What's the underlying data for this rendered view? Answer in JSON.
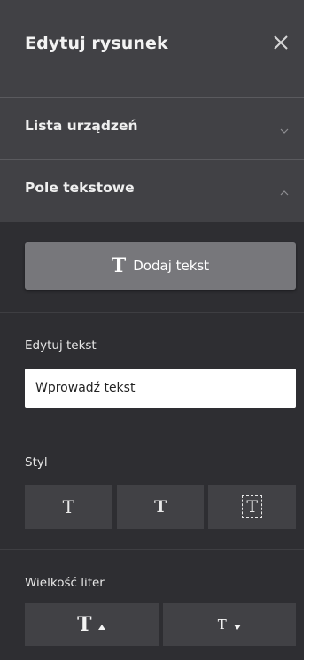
{
  "header": {
    "title": "Edytuj rysunek",
    "close_icon": "close-icon"
  },
  "sections": [
    {
      "label": "Lista urządzeń",
      "expanded": false,
      "icon": "chevron-down-icon"
    },
    {
      "label": "Pole tekstowe",
      "expanded": true,
      "icon": "chevron-up-icon"
    }
  ],
  "text_box": {
    "add_button": {
      "icon": "T",
      "label": "Dodaj tekst"
    },
    "edit_label": "Edytuj tekst",
    "input": {
      "value": "",
      "placeholder": "Wprowadź tekst"
    },
    "style_label": "Styl",
    "style_buttons": [
      {
        "icon": "T",
        "name": "text-style-normal"
      },
      {
        "icon": "T",
        "name": "text-style-bold"
      },
      {
        "icon": "T",
        "name": "text-style-boxed"
      }
    ],
    "size_label": "Wielkość liter",
    "size_buttons": [
      {
        "icon": "T",
        "arrow": "up",
        "name": "increase-font-size"
      },
      {
        "icon": "T",
        "arrow": "down",
        "name": "decrease-font-size"
      }
    ]
  },
  "colors": {
    "panel_bg": "#2e2e32",
    "header_bg": "#414145",
    "button_bg": "#77777b",
    "text": "#f1f1f1"
  }
}
